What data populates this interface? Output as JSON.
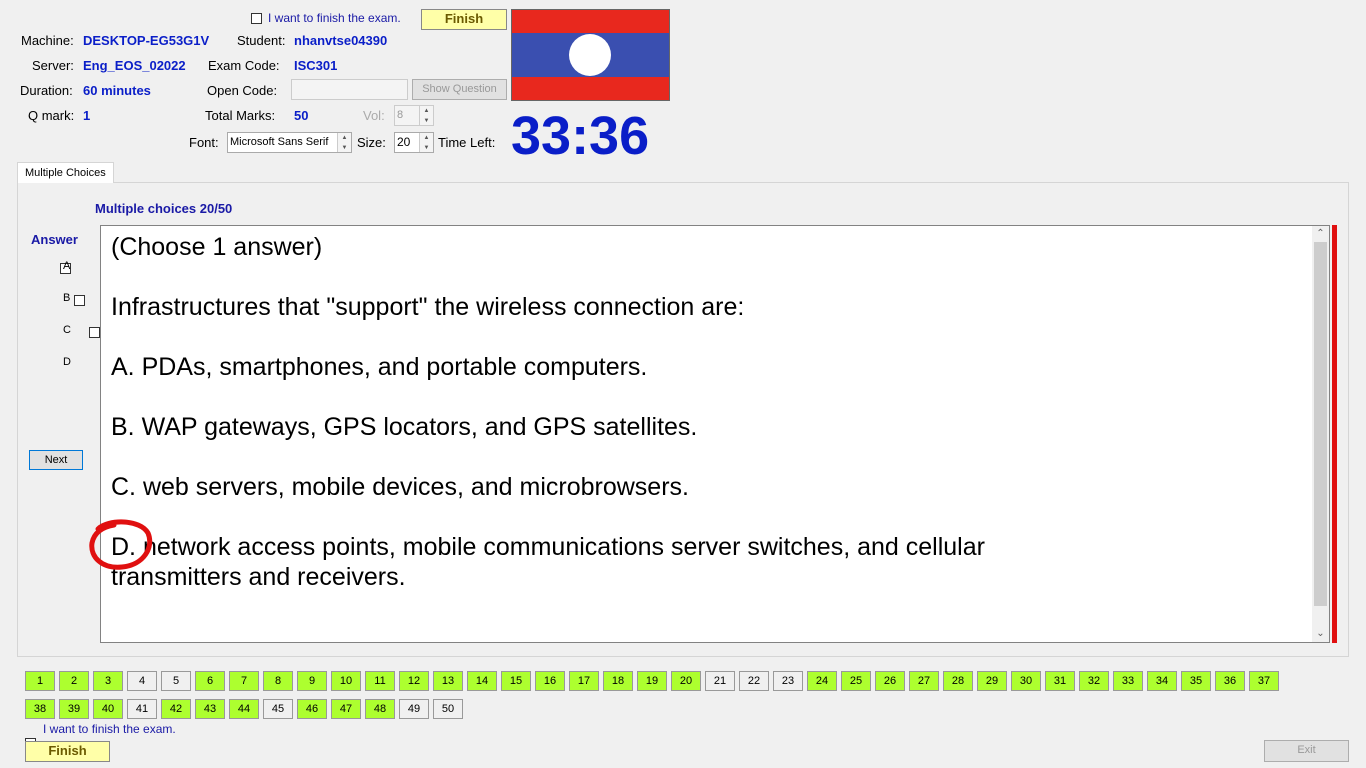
{
  "header": {
    "finish_checkbox_label": "I want to finish the exam.",
    "finish_button": "Finish",
    "machine_label": "Machine:",
    "machine_value": "DESKTOP-EG53G1V",
    "student_label": "Student:",
    "student_value": "nhanvtse04390",
    "server_label": "Server:",
    "server_value": "Eng_EOS_02022",
    "exam_code_label": "Exam Code:",
    "exam_code_value": "ISC301",
    "duration_label": "Duration:",
    "duration_value": "60 minutes",
    "open_code_label": "Open Code:",
    "open_code_value": "",
    "show_question_button": "Show Question",
    "qmark_label": "Q mark:",
    "qmark_value": "1",
    "total_marks_label": "Total Marks:",
    "total_marks_value": "50",
    "vol_label": "Vol:",
    "vol_value": "8",
    "font_label": "Font:",
    "font_value": "Microsoft Sans Serif",
    "size_label": "Size:",
    "size_value": "20",
    "time_left_label": "Time Left:",
    "time_left_value": "33:36"
  },
  "tab": {
    "label": "Multiple Choices"
  },
  "question": {
    "title": "Multiple choices 20/50",
    "answer_label": "Answer",
    "options": [
      {
        "letter": "A",
        "checked": false
      },
      {
        "letter": "B",
        "checked": false
      },
      {
        "letter": "C",
        "checked": false
      },
      {
        "letter": "D",
        "checked": true
      }
    ],
    "next_button": "Next",
    "instruction": "(Choose 1 answer)",
    "stem": "Infrastructures that \"support\" the wireless connection are:",
    "choice_a": "A.  PDAs, smartphones, and portable computers.",
    "choice_b": "B.  WAP gateways, GPS locators, and GPS satellites.",
    "choice_c": "C.  web servers, mobile devices, and microbrowsers.",
    "choice_d": "D.  network access points, mobile communications server switches, and cellular transmitters and receivers."
  },
  "question_nav": {
    "numbers": [
      "1",
      "2",
      "3",
      "4",
      "5",
      "6",
      "7",
      "8",
      "9",
      "10",
      "11",
      "12",
      "13",
      "14",
      "15",
      "16",
      "17",
      "18",
      "19",
      "20",
      "21",
      "22",
      "23",
      "24",
      "25",
      "26",
      "27",
      "28",
      "29",
      "30",
      "31",
      "32",
      "33",
      "34",
      "35",
      "36",
      "37",
      "38",
      "39",
      "40",
      "41",
      "42",
      "43",
      "44",
      "45",
      "46",
      "47",
      "48",
      "49",
      "50"
    ],
    "answered": [
      true,
      true,
      true,
      false,
      false,
      true,
      true,
      true,
      true,
      true,
      true,
      true,
      true,
      true,
      true,
      true,
      true,
      true,
      true,
      true,
      false,
      false,
      false,
      true,
      true,
      true,
      true,
      true,
      true,
      true,
      true,
      true,
      true,
      true,
      true,
      true,
      true,
      true,
      true,
      true,
      false,
      true,
      true,
      true,
      false,
      true,
      true,
      true,
      false,
      false
    ]
  },
  "footer": {
    "finish_checkbox_label": "I want to finish the exam.",
    "finish_button": "Finish",
    "exit_button": "Exit"
  },
  "colors": {
    "accent_blue": "#0a1ec8",
    "answered_green": "#adff2f",
    "finish_yellow": "#ffffa8",
    "flag_red": "#e8281e",
    "flag_blue": "#3a4fb0",
    "annotation_red": "#e01010"
  }
}
